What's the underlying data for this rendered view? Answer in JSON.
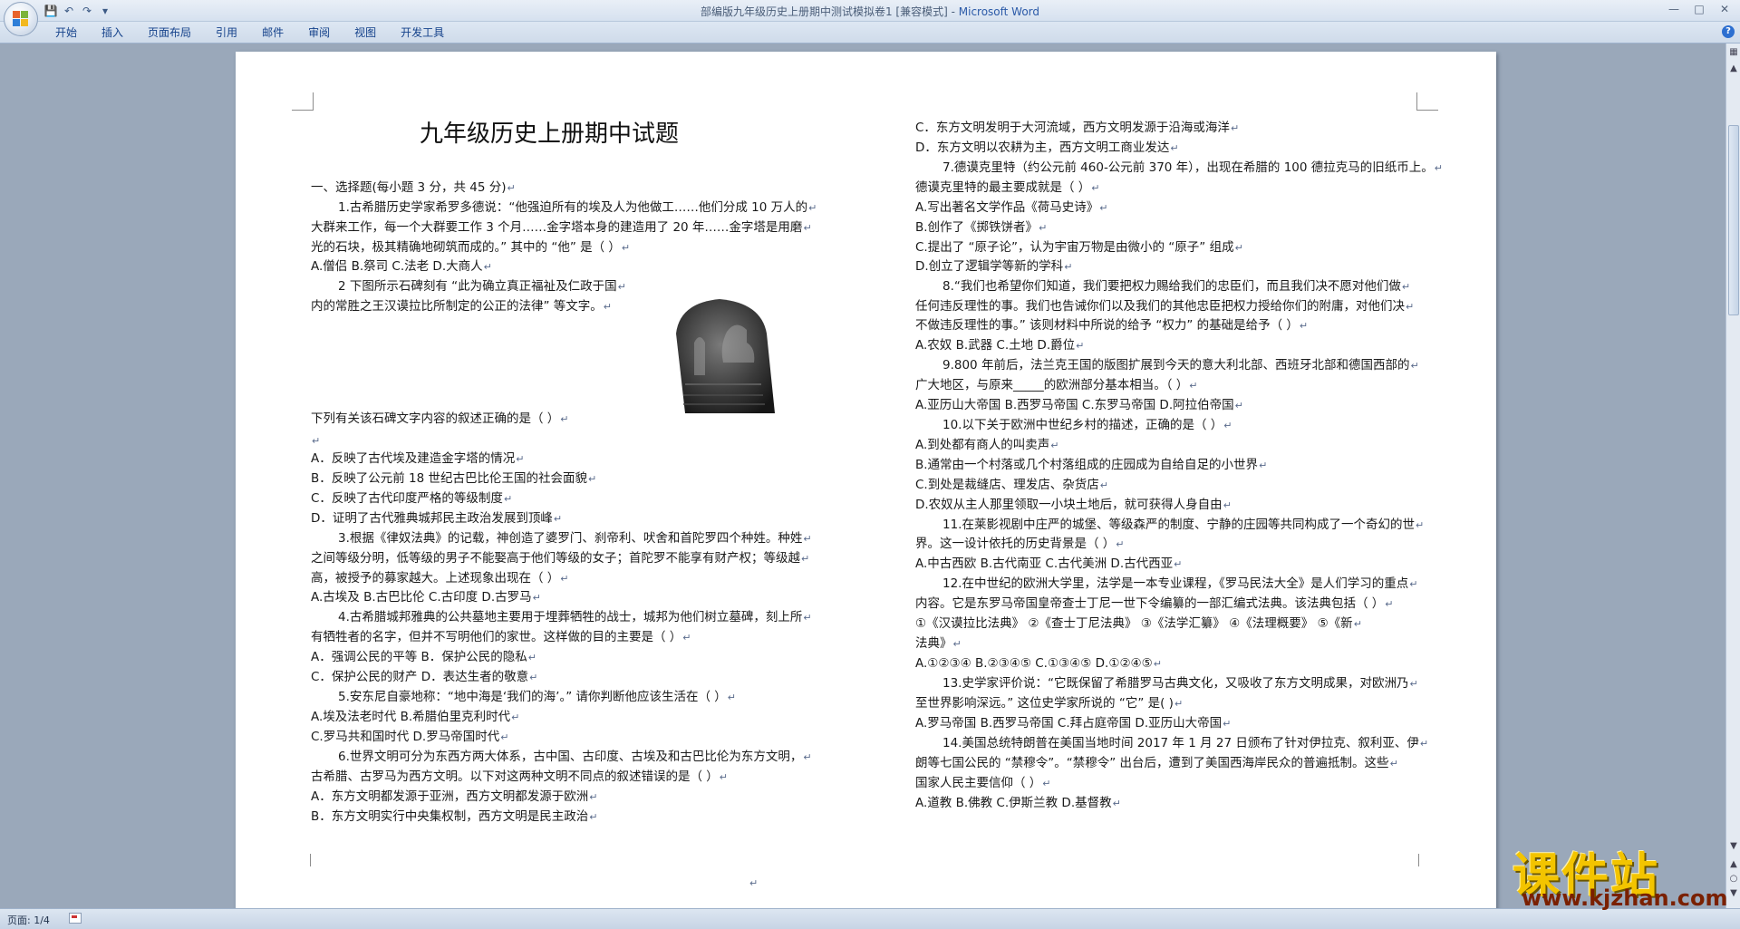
{
  "window": {
    "title": "部编版九年级历史上册期中测试模拟卷1 [兼容模式]",
    "app_name": "Microsoft Word",
    "separator": " - "
  },
  "quick_access": [
    "save-icon",
    "undo-icon",
    "redo-icon",
    "customize-icon"
  ],
  "ribbon": {
    "tabs": [
      "开始",
      "插入",
      "页面布局",
      "引用",
      "邮件",
      "审阅",
      "视图",
      "开发工具"
    ]
  },
  "document": {
    "title": "九年级历史上册期中试题",
    "left_lines": [
      "一、选择题(每小题 3 分，共 45 分)",
      "1.古希腊历史学家希罗多德说：“他强迫所有的埃及人为他做工……他们分成 10 万人的",
      "大群来工作，每一个大群要工作 3 个月……金字塔本身的建造用了 20 年……金字塔是用磨",
      "光的石块，极其精确地砌筑而成的。” 其中的 “他” 是（     ）",
      "A.僧侣        B.祭司        C.法老        D.大商人",
      "2 下图所示石碑刻有 “此为确立真正福祉及仁政于国",
      "内的常胜之王汉谟拉比所制定的公正的法律” 等文字。",
      "下列有关该石碑文字内容的叙述正确的是（     ）",
      "",
      "A．反映了古代埃及建造金字塔的情况",
      "B．反映了公元前 18 世纪古巴比伦王国的社会面貌",
      "C．反映了古代印度严格的等级制度",
      "D．证明了古代雅典城邦民主政治发展到顶峰",
      "3.根据《律奴法典》的记载，神创造了婆罗门、刹帝利、吠舍和首陀罗四个种姓。种姓",
      "之间等级分明，低等级的男子不能娶高于他们等级的女子；首陀罗不能享有财产权；等级越",
      "高，被授予的募家越大。上述现象出现在（     ）",
      "A.古埃及    B.古巴比伦     C.古印度     D.古罗马",
      "4.古希腊城邦雅典的公共墓地主要用于埋葬牺牲的战士，城邦为他们树立墓碑，刻上所",
      "有牺牲者的名字，但并不写明他们的家世。这样做的目的主要是（      ）",
      "A．强调公民的平等                       B．保护公民的隐私",
      "C．保护公民的财产                       D．表达生者的敬意",
      "5.安东尼自豪地称：“地中海是‘我们的海’。” 请你判断他应该生活在（    ）",
      "A.埃及法老时代                          B.希腊伯里克利时代",
      "C.罗马共和国时代                        D.罗马帝国时代",
      "6.世界文明可分为东西方两大体系，古中国、古印度、古埃及和古巴比伦为东方文明，",
      "古希腊、古罗马为西方文明。以下对这两种文明不同点的叙述错误的是（      ）",
      "A．东方文明都发源于亚洲，西方文明都发源于欧洲",
      "B．东方文明实行中央集权制，西方文明是民主政治"
    ],
    "right_lines": [
      "C．东方文明发明于大河流域，西方文明发源于沿海或海洋",
      "D．东方文明以农耕为主，西方文明工商业发达",
      "7.德谟克里特（约公元前 460-公元前 370 年），出现在希腊的 100 德拉克马的旧纸币上。",
      "德谟克里特的最主要成就是（      ）",
      "A.写出著名文学作品《荷马史诗》",
      "B.创作了《掷铁饼者》",
      "C.提出了 “原子论”，认为宇宙万物是由微小的 “原子” 组成",
      "D.创立了逻辑学等新的学科",
      "8.“我们也希望你们知道，我们要把权力赐给我们的忠臣们，而且我们决不愿对他们做",
      "任何违反理性的事。我们也告诫你们以及我们的其他忠臣把权力授给你们的附庸，对他们决",
      "不做违反理性的事。” 该则材料中所说的给予 “权力” 的基础是给予（     ）",
      "A.农奴             B.武器             C.土地             D.爵位",
      "9.800 年前后，法兰克王国的版图扩展到今天的意大利北部、西班牙北部和德国西部的",
      "广大地区，与原来_____的欧洲部分基本相当。（     ）",
      "A.亚历山大帝国     B.西罗马帝国     C.东罗马帝国     D.阿拉伯帝国",
      "10.以下关于欧洲中世纪乡村的描述，正确的是（      ）",
      "A.到处都有商人的叫卖声",
      "B.通常由一个村落或几个村落组成的庄园成为自给自足的小世界",
      "C.到处是裁缝店、理发店、杂货店",
      "D.农奴从主人那里领取一小块土地后，就可获得人身自由",
      "11.在莱影视剧中庄严的城堡、等级森严的制度、宁静的庄园等共同构成了一个奇幻的世",
      "界。这一设计依托的历史背景是（       ）",
      "A.中古西欧      B.古代南亚      C.古代美洲      D.古代西亚",
      "12.在中世纪的欧洲大学里，法学是一本专业课程，《罗马民法大全》是人们学习的重点",
      "内容。它是东罗马帝国皇帝查士丁尼一世下令编纂的一部汇编式法典。该法典包括（     ）",
      "①《汉谟拉比法典》   ②《查士丁尼法典》   ③《法学汇纂》   ④《法理概要》   ⑤《新",
      "法典》",
      "A.①②③④      B.②③④⑤      C.①③④⑤      D.①②④⑤",
      "13.史学家评价说：“它既保留了希腊罗马古典文化，又吸收了东方文明成果，对欧洲乃",
      "至世界影响深远。” 这位史学家所说的 “它” 是(     )",
      "A.罗马帝国       B.西罗马帝国       C.拜占庭帝国       D.亚历山大帝国",
      "14.美国总统特朗普在美国当地时间 2017 年 1 月 27 日颁布了针对伊拉克、叙利亚、伊",
      "朗等七国公民的 “禁穆令”。“禁穆令” 出台后，遭到了美国西海岸民众的普遍抵制。这些",
      "国家人民主要信仰（     ）",
      "A.道教     B.佛教     C.伊斯兰教     D.基督教"
    ]
  },
  "status": {
    "page_label": "页面: 1/4"
  },
  "watermark": {
    "main": "课件站",
    "url": "www.kjzhan.com"
  },
  "colors": {
    "ribbon_text": "#15428b",
    "app_name": "#2b5aa8",
    "workspace": "#9aa8ba",
    "watermark_yellow": "#f3c400"
  }
}
